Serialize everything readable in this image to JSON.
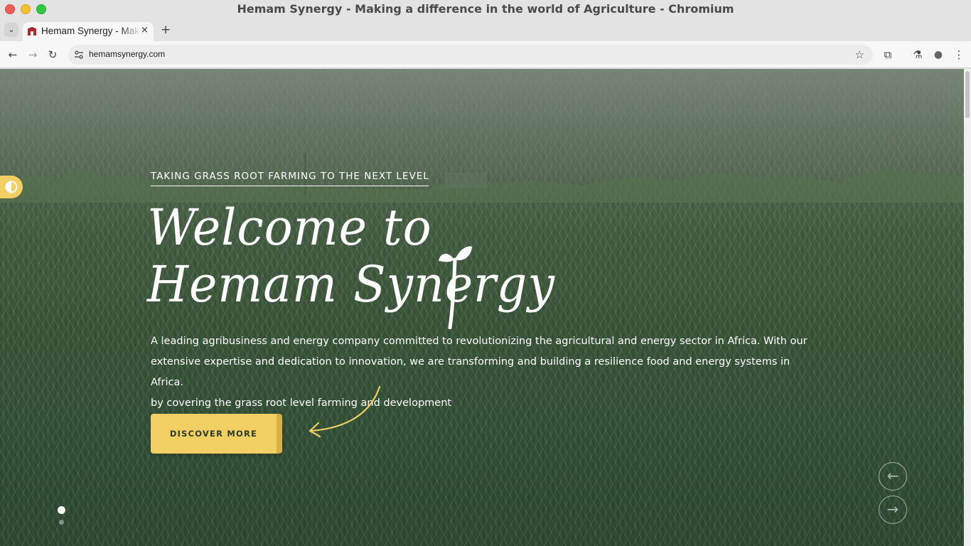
{
  "window": {
    "title": "Hemam Synergy - Making a difference in the world of Agriculture - Chromium"
  },
  "tab": {
    "title": "Hemam Synergy - Making a difference in the world of Agriculture",
    "close_icon": "×",
    "new_tab_icon": "+",
    "menu_icon": "⌄"
  },
  "toolbar": {
    "back_icon": "←",
    "forward_icon": "→",
    "reload_icon": "↻",
    "url": "hemamsynergy.com",
    "bookmark_icon": "☆",
    "extensions_icon": "⧉",
    "labs_icon": "⚗",
    "profile_icon": "●",
    "menu_icon": "⋮"
  },
  "hero": {
    "tagline": "TAKING GRASS ROOT FARMING TO THE NEXT LEVEL",
    "title_line1": "Welcome to",
    "title_line2": "Hemam Synergy",
    "description_line1": "A leading agribusiness and energy company committed to revolutionizing the agricultural and energy sector in Africa. With our extensive expertise and dedication to innovation, we are transforming and building a resilience food and energy systems in Africa.",
    "description_line2": "by covering the grass root level farming and development",
    "cta_label": "DISCOVER MORE",
    "prev_icon": "←",
    "next_icon": "→",
    "slides_total": 2,
    "active_slide": 1
  },
  "colors": {
    "accent": "#f1cf63",
    "field_green": "#3c5a3b"
  }
}
